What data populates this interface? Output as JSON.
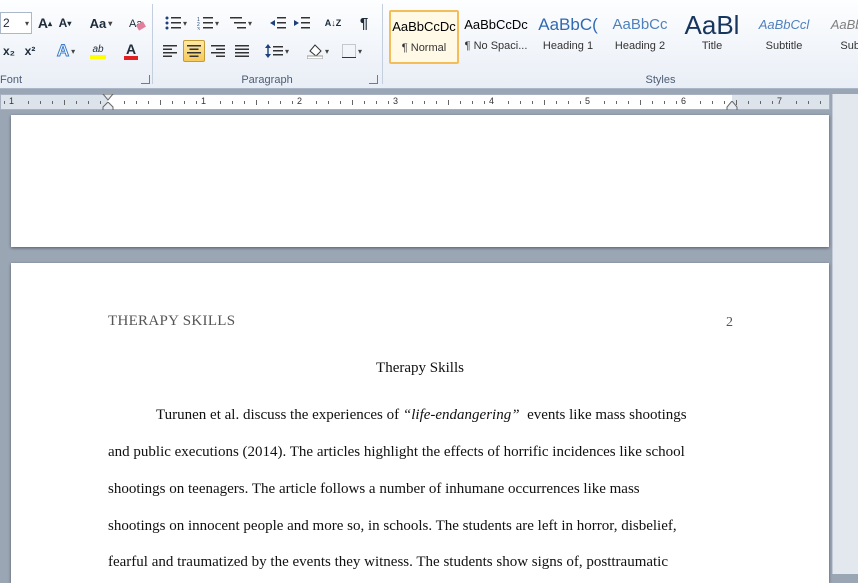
{
  "ribbon": {
    "font_group_label": "Font",
    "paragraph_group_label": "Paragraph",
    "styles_group_label": "Styles",
    "font_size_value": "2",
    "change_case_label": "Aa",
    "grow_font_label": "A",
    "shrink_font_label": "A",
    "subscript_label": "x₂",
    "superscript_label": "x²",
    "font_color_label": "A",
    "highlight_label": "ab",
    "sort_label": "A↓Z",
    "pilcrow_label": "¶"
  },
  "styles": [
    {
      "sample": "AaBbCcDc",
      "name": "¶ Normal",
      "color": "#000000",
      "size": "13px",
      "selected": true
    },
    {
      "sample": "AaBbCcDc",
      "name": "¶ No Spaci...",
      "color": "#000000",
      "size": "13px"
    },
    {
      "sample": "AaBbC(",
      "name": "Heading 1",
      "color": "#2f6ab2",
      "size": "17px"
    },
    {
      "sample": "AaBbCc",
      "name": "Heading 2",
      "color": "#4f81bd",
      "size": "15px"
    },
    {
      "sample": "AaBl",
      "name": "Title",
      "color": "#17365d",
      "size": "26px"
    },
    {
      "sample": "AaBbCcl",
      "name": "Subtitle",
      "color": "#4f81bd",
      "size": "13px"
    },
    {
      "sample": "AaBbCcl",
      "name": "Subtle",
      "color": "#7f7f7f",
      "size": "13px"
    }
  ],
  "ruler_numbers": [
    "1",
    "1",
    "2",
    "3",
    "4",
    "5",
    "6",
    "7"
  ],
  "document": {
    "header_left": "THERAPY SKILLS",
    "page_number": "2",
    "title": "Therapy Skills",
    "line1_a": "Turunen et al. discuss the experiences of ",
    "line1_italic": "“life-endangering”",
    "line1_b": "  events like mass shootings",
    "line2": "and public executions (2014). The articles highlight the effects of horrific incidences like school",
    "line3": "shootings on teenagers. The article follows a number of inhumane occurrences like mass",
    "line4": "shootings on innocent people and more so, in schools. The students are left in horror, disbelief,",
    "line5": "fearful and traumatized by the events they witness. The students show signs of, posttraumatic"
  }
}
